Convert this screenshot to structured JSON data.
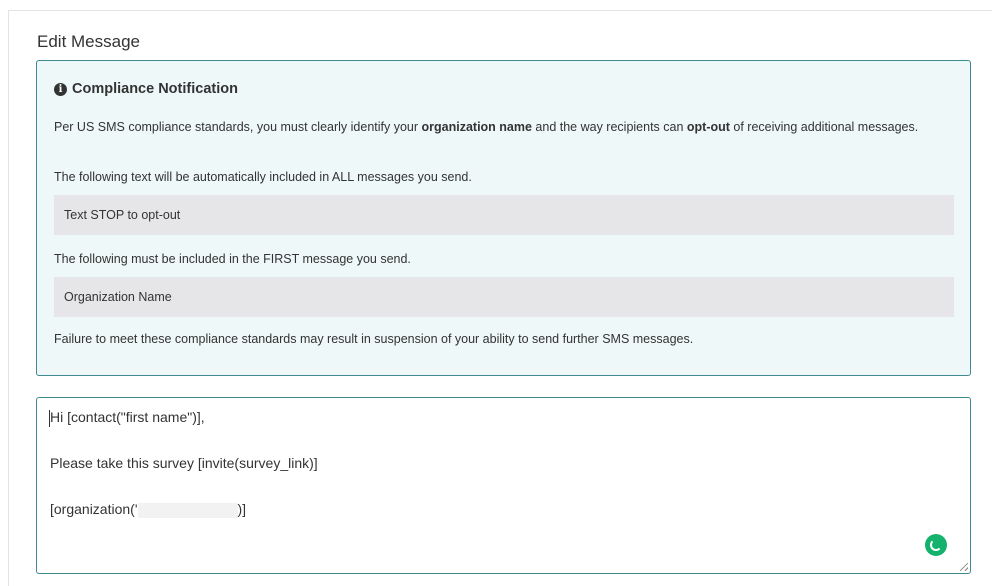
{
  "page": {
    "heading": "Edit Message"
  },
  "compliance": {
    "title": "Compliance Notification",
    "icon": "info-circle-icon",
    "para1_pre": "Per US SMS compliance standards, you must clearly identify your ",
    "para1_bold1": "organization name",
    "para1_mid": " and the way recipients can ",
    "para1_bold2": "opt-out",
    "para1_post": " of receiving additional messages.",
    "para2": "The following text will be automatically included in ALL messages you send.",
    "optout_text": "Text STOP to opt-out",
    "para3": "The following must be included in the FIRST message you send.",
    "org_text": "Organization Name",
    "para4": "Failure to meet these compliance standards may result in suspension of your ability to send further SMS messages."
  },
  "editor": {
    "line1": "Hi [contact(\"first name\")],",
    "line2": "Please take this survey [invite(survey_link)]",
    "line3_pre": "[organization('",
    "line3_post": ")]",
    "status_icon": "grammar-check-icon"
  },
  "colors": {
    "notice_bg": "#eef8f8",
    "border": "#3f8a8f",
    "code_bg": "#e6e6e8",
    "status": "#14b26d"
  }
}
